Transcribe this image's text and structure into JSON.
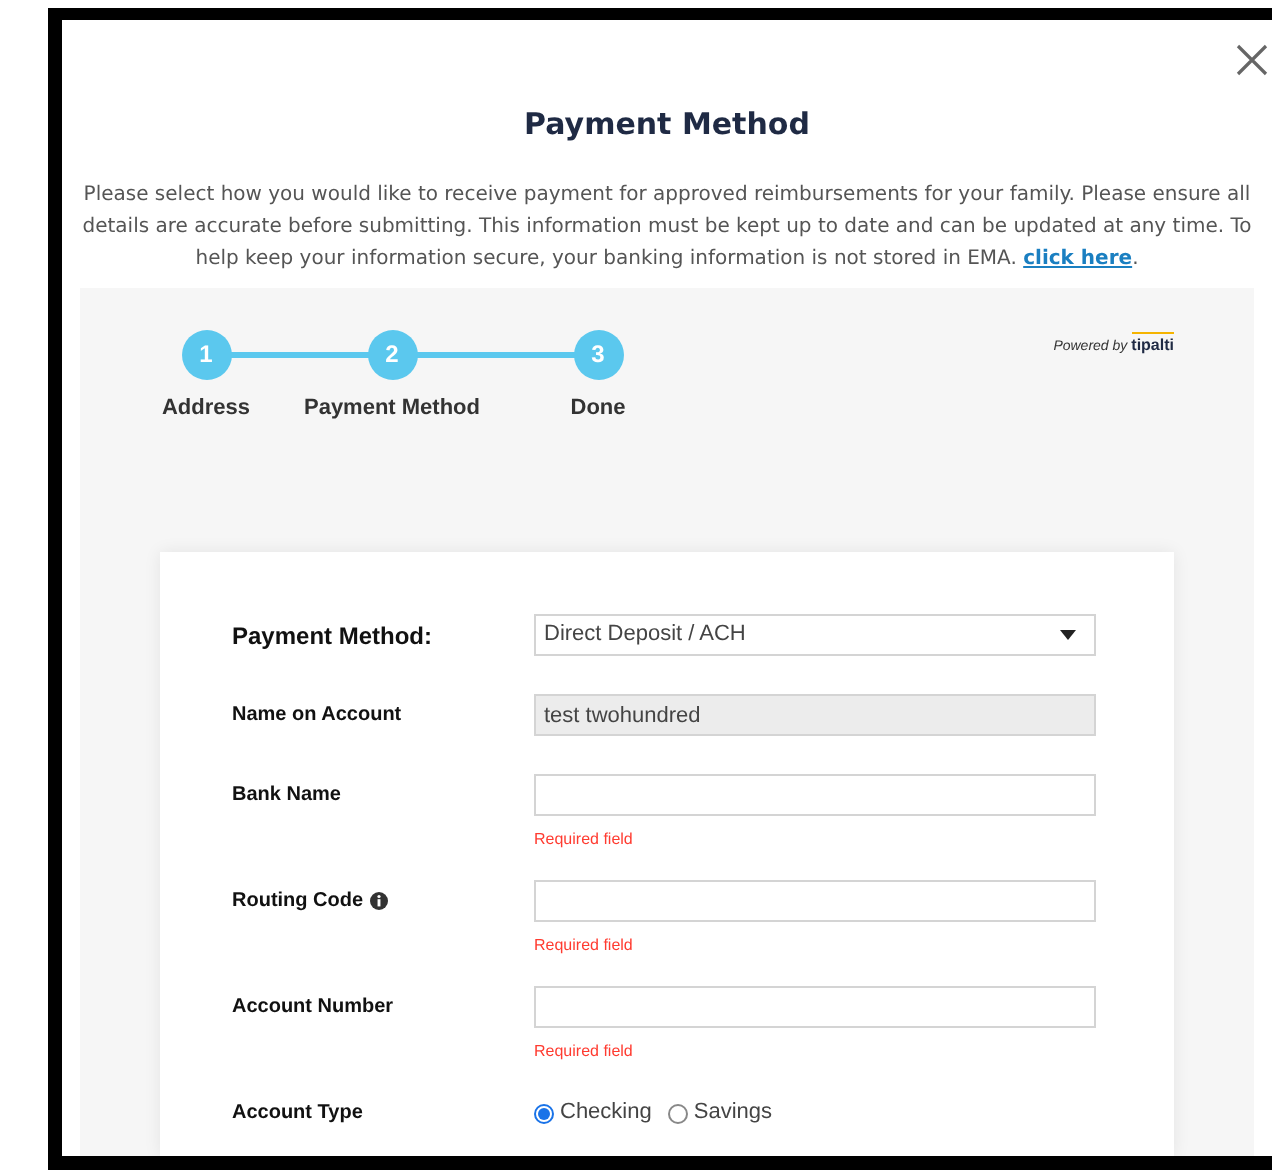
{
  "dialog": {
    "title": "Payment Method",
    "intro": "Please select how you would like to receive payment for approved reimbursements for your family. Please ensure all details are accurate before submitting. This information must be kept up to date and can be updated at any time. To help keep your information secure, your banking information is not stored in EMA.",
    "intro_link": "click here",
    "intro_end": "."
  },
  "powered_by": {
    "text": "Powered by",
    "brand": "tipalti"
  },
  "steps": [
    {
      "number": "1",
      "label": "Address"
    },
    {
      "number": "2",
      "label": "Payment Method"
    },
    {
      "number": "3",
      "label": "Done"
    }
  ],
  "form": {
    "fields": [
      {
        "kind": "select",
        "label": "Payment Method:",
        "value": "Direct Deposit / ACH"
      },
      {
        "kind": "readonly",
        "label": "Name on Account",
        "value": "test twohundred"
      },
      {
        "kind": "text",
        "label": "Bank Name",
        "error": "Required field"
      },
      {
        "kind": "text",
        "label": "Routing Code",
        "info": true,
        "error": "Required field"
      },
      {
        "kind": "text",
        "label": "Account Number",
        "error": "Required field"
      },
      {
        "kind": "radio",
        "label": "Account Type",
        "options": [
          {
            "label": "Checking",
            "selected": true
          },
          {
            "label": "Savings",
            "selected": false
          }
        ]
      }
    ]
  }
}
